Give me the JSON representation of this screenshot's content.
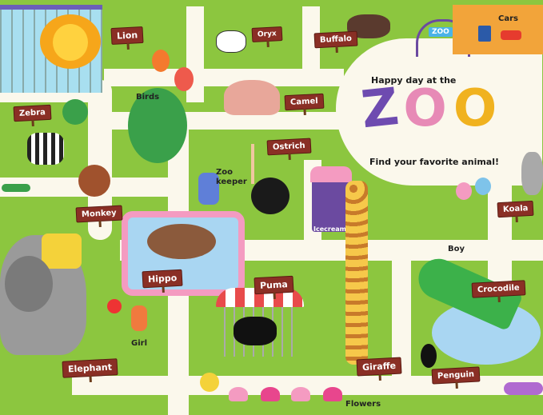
{
  "title": {
    "line1": "Happy day at the",
    "big_letters": [
      "Z",
      "O",
      "O"
    ],
    "line2": "Find your favorite animal!",
    "gate_sign": "ZOO"
  },
  "signs": {
    "lion": "Lion",
    "oryx": "Oryx",
    "buffalo": "Buffalo",
    "zebra": "Zebra",
    "camel": "Camel",
    "ostrich": "Ostrich",
    "monkey": "Monkey",
    "koala": "Koala",
    "hippo": "Hippo",
    "puma": "Puma",
    "crocodile": "Crocodile",
    "elephant": "Elephant",
    "giraffe": "Giraffe",
    "penguin": "Penguin"
  },
  "labels": {
    "cars": "Cars",
    "birds": "Birds",
    "zookeeper_line1": "Zoo",
    "zookeeper_line2": "keeper",
    "icecream": "Icecream",
    "boy": "Boy",
    "girl": "Girl",
    "flowers": "Flowers"
  },
  "colors": {
    "grass": "#8cc63f",
    "path": "#fbf8ec",
    "sign": "#8a2f25",
    "water": "#a9d6f2",
    "pool_border": "#f49bc1"
  }
}
